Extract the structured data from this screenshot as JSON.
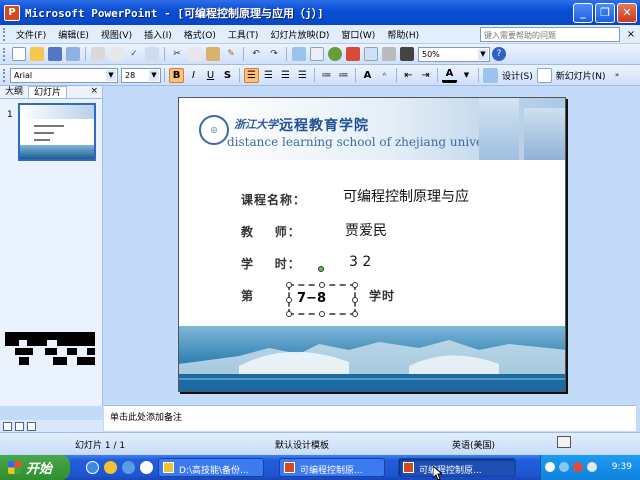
{
  "window": {
    "title": "Microsoft PowerPoint - [可编程控制原理与应用（j）]",
    "app_icon": "powerpoint-icon",
    "controls": [
      "minimize",
      "restore",
      "close"
    ]
  },
  "menubar": {
    "items": [
      "文件(F)",
      "编辑(E)",
      "视图(V)",
      "插入(I)",
      "格式(O)",
      "工具(T)",
      "幻灯片放映(D)",
      "窗口(W)",
      "帮助(H)"
    ],
    "ask_placeholder": "键入需要帮助的问题",
    "close_glyph": "×"
  },
  "toolbar": {
    "zoom": "50%"
  },
  "format_toolbar": {
    "font": "Arial",
    "size": "28",
    "bold": "B",
    "italic": "I",
    "underline": "U",
    "shadow": "S",
    "grow": "A",
    "font_color": "A",
    "design_label": "设计(S)",
    "new_slide_label": "新幻灯片(N)"
  },
  "left_panel": {
    "tabs": [
      "大纲",
      "幻灯片"
    ],
    "close_glyph": "×",
    "slide_number": "1"
  },
  "slide": {
    "header_brand": "浙江大学",
    "school_name": "远程教育学院",
    "school_english": "distance learning school of zhejiang university",
    "rows": [
      {
        "label": "课程名称：",
        "value": "可编程控制原理与应"
      },
      {
        "label": "教    师：",
        "value": "贾爱民"
      },
      {
        "label": "学    时：",
        "value": "3 2"
      }
    ],
    "week_label": "第",
    "week_value": "7−8",
    "week_suffix": "学时"
  },
  "notes": {
    "placeholder": "单击此处添加备注"
  },
  "statusbar": {
    "slide_position": "幻灯片 1 / 1",
    "template": "默认设计模板",
    "language": "英语(美国)"
  },
  "taskbar": {
    "start_label": "开始",
    "tasks": [
      {
        "label": "D:\\高技能\\备份...",
        "active": false
      },
      {
        "label": "可编程控制原...",
        "active": false
      },
      {
        "label": "可编程控制原...",
        "active": true
      }
    ],
    "clock": "9:39"
  },
  "colors": {
    "titlebar": "#0a4fd6",
    "workspace": "#c3daf9",
    "taskbar": "#245edc",
    "start": "#3c9a3c",
    "school_blue": "#1f4f96"
  }
}
